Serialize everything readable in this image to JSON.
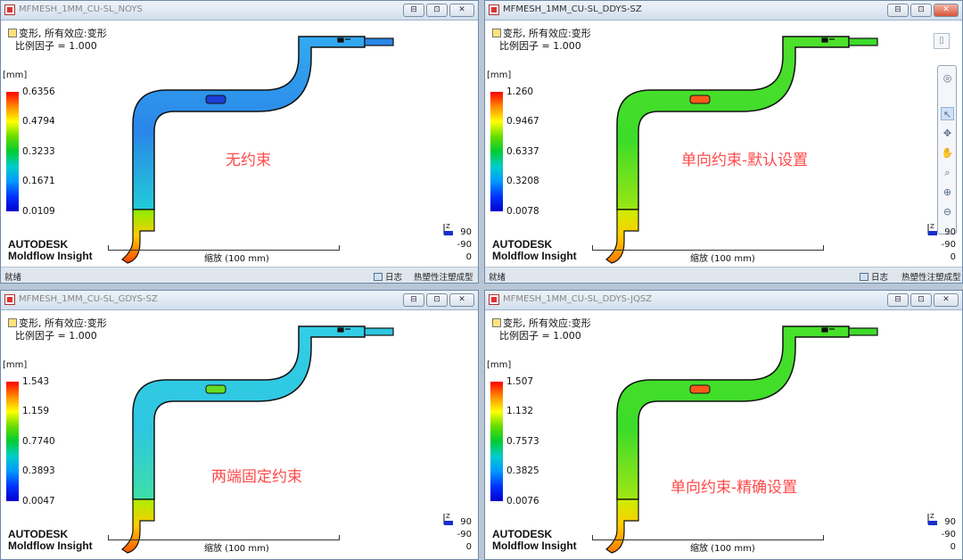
{
  "windows": [
    {
      "title": "MFMESH_1MM_CU-SL_NOYS",
      "header_line1": "变形, 所有效应:变形",
      "header_line2": "比例因子 = 1.000",
      "unit": "[mm]",
      "legend": [
        "0.6356",
        "0.4794",
        "0.3233",
        "0.1671",
        "0.0109"
      ],
      "annotation": "无约束",
      "brand_line1": "AUTODESK",
      "brand_line2": "Moldflow Insight",
      "scale_label": "缩放 (100 mm)",
      "axis": [
        "Z",
        "90",
        "-90",
        "0"
      ],
      "status_ready": "就绪",
      "status_log": "日志",
      "status_mode": "热塑性注塑成型",
      "buttons": [
        "⊟",
        "⊡",
        "✕"
      ],
      "colors": {
        "main": "#2a86e8",
        "body_top": "#33aaf0",
        "body_mid": "#22ccd8",
        "leg_lower": "#88ee00",
        "tip": "#ff5500",
        "pin": "#1a3fd8"
      }
    },
    {
      "title": "MFMESH_1MM_CU-SL_DDYS-SZ",
      "header_line1": "变形, 所有效应:变形",
      "header_line2": "比例因子 = 1.000",
      "unit": "[mm]",
      "legend": [
        "1.260",
        "0.9467",
        "0.6337",
        "0.3208",
        "0.0078"
      ],
      "annotation": "单向约束-默认设置",
      "brand_line1": "AUTODESK",
      "brand_line2": "Moldflow Insight",
      "scale_label": "缩放 (100 mm)",
      "axis": [
        "Z",
        "90",
        "-90",
        "0"
      ],
      "status_ready": "就绪",
      "status_log": "日志",
      "status_mode": "热塑性注塑成型",
      "buttons": [
        "⊟",
        "⊡",
        "✕"
      ],
      "colors": {
        "main": "#3ddc2a",
        "body_top": "#4ee02c",
        "body_mid": "#7fe61a",
        "leg_lower": "#ffcc00",
        "tip": "#ff7700",
        "pin": "#ff5a1a"
      }
    },
    {
      "title": "MFMESH_1MM_CU-SL_GDYS-SZ",
      "header_line1": "变形, 所有效应:变形",
      "header_line2": "比例因子 = 1.000",
      "unit": "[mm]",
      "legend": [
        "1.543",
        "1.159",
        "0.7740",
        "0.3893",
        "0.0047"
      ],
      "annotation": "两端固定约束",
      "brand_line1": "AUTODESK",
      "brand_line2": "Moldflow Insight",
      "scale_label": "缩放 (100 mm)",
      "axis": [
        "Z",
        "90",
        "-90",
        "0"
      ],
      "status_ready": "",
      "status_log": "",
      "status_mode": "",
      "buttons": [
        "⊟",
        "⊡",
        "✕"
      ],
      "colors": {
        "main": "#2ec6e0",
        "body_top": "#33cde6",
        "body_mid": "#39e0b8",
        "leg_lower": "#ffcc00",
        "tip": "#ff6a00",
        "pin": "#66dd22"
      }
    },
    {
      "title": "MFMESH_1MM_CU-SL_DDYS-JQSZ",
      "header_line1": "变形, 所有效应:变形",
      "header_line2": "比例因子 = 1.000",
      "unit": "[mm]",
      "legend": [
        "1.507",
        "1.132",
        "0.7573",
        "0.3825",
        "0.0076"
      ],
      "annotation": "单向约束-精确设置",
      "brand_line1": "AUTODESK",
      "brand_line2": "Moldflow Insight",
      "scale_label": "缩放 (100 mm)",
      "axis": [
        "Z",
        "90",
        "-90",
        "0"
      ],
      "status_ready": "",
      "status_log": "",
      "status_mode": "",
      "buttons": [
        "⊟",
        "⊡",
        "✕"
      ],
      "colors": {
        "main": "#3ddc2a",
        "body_top": "#48e02a",
        "body_mid": "#86e612",
        "leg_lower": "#ffcc00",
        "tip": "#ff7700",
        "pin": "#ff5a1a"
      }
    }
  ],
  "view_toolbar": {
    "icons": [
      "orbit-ring-icon",
      "select-arrow-icon",
      "move-icon",
      "pan-hand-icon",
      "zoom-region-icon",
      "zoom-icon",
      "zoom-fit-icon"
    ],
    "glyphs": [
      "◎",
      "↖",
      "✥",
      "✋",
      "⌕",
      "⊕",
      "⊖"
    ]
  }
}
